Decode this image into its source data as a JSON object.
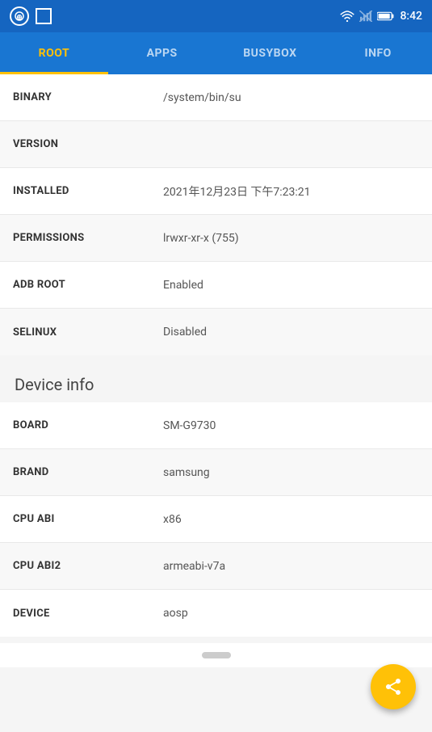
{
  "statusBar": {
    "time": "8:42"
  },
  "tabs": [
    {
      "id": "root",
      "label": "ROOT",
      "active": true
    },
    {
      "id": "apps",
      "label": "APPS",
      "active": false
    },
    {
      "id": "busybox",
      "label": "BUSYBOX",
      "active": false
    },
    {
      "id": "info",
      "label": "INFO",
      "active": false
    }
  ],
  "rootInfo": [
    {
      "label": "BINARY",
      "value": "/system/bin/su",
      "alt": false
    },
    {
      "label": "VERSION",
      "value": "",
      "alt": true
    },
    {
      "label": "INSTALLED",
      "value": "2021年12月23日 下午7:23:21",
      "alt": false
    },
    {
      "label": "PERMISSIONS",
      "value": "lrwxr-xr-x (755)",
      "alt": true
    },
    {
      "label": "ADB ROOT",
      "value": "Enabled",
      "alt": false
    },
    {
      "label": "SELINUX",
      "value": "Disabled",
      "alt": true
    }
  ],
  "deviceInfo": {
    "sectionTitle": "Device info",
    "rows": [
      {
        "label": "BOARD",
        "value": "SM-G9730",
        "alt": false
      },
      {
        "label": "BRAND",
        "value": "samsung",
        "alt": true
      },
      {
        "label": "CPU ABI",
        "value": "x86",
        "alt": false
      },
      {
        "label": "CPU ABI2",
        "value": "armeabi-v7a",
        "alt": true
      },
      {
        "label": "DEVICE",
        "value": "aosp",
        "alt": false
      }
    ]
  },
  "fab": {
    "label": "share"
  }
}
